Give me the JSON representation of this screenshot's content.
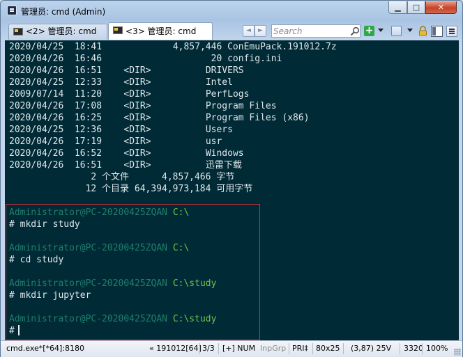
{
  "window": {
    "title": "管理员: cmd (Admin)",
    "controls": {
      "minimize": "▁",
      "maximize": "□",
      "close": "✕"
    }
  },
  "tabs": [
    {
      "label": "<2> 管理员: cmd",
      "active": false
    },
    {
      "label": "<3> 管理员: cmd",
      "active": true
    }
  ],
  "toolbar": {
    "search_placeholder": "Search",
    "nav_left": "◄",
    "nav_right": "►",
    "plus": "+"
  },
  "console": {
    "listing": [
      {
        "date": "2020/04/25",
        "time": "18:41",
        "type": "",
        "size": "4,857,446",
        "name": "ConEmuPack.191012.7z"
      },
      {
        "date": "2020/04/26",
        "time": "16:46",
        "type": "",
        "size": "20",
        "name": "config.ini"
      },
      {
        "date": "2020/04/26",
        "time": "16:51",
        "type": "<DIR>",
        "size": "",
        "name": "DRIVERS"
      },
      {
        "date": "2020/04/25",
        "time": "12:33",
        "type": "<DIR>",
        "size": "",
        "name": "Intel"
      },
      {
        "date": "2009/07/14",
        "time": "11:20",
        "type": "<DIR>",
        "size": "",
        "name": "PerfLogs"
      },
      {
        "date": "2020/04/26",
        "time": "17:08",
        "type": "<DIR>",
        "size": "",
        "name": "Program Files"
      },
      {
        "date": "2020/04/26",
        "time": "16:25",
        "type": "<DIR>",
        "size": "",
        "name": "Program Files (x86)"
      },
      {
        "date": "2020/04/25",
        "time": "12:36",
        "type": "<DIR>",
        "size": "",
        "name": "Users"
      },
      {
        "date": "2020/04/26",
        "time": "17:19",
        "type": "<DIR>",
        "size": "",
        "name": "usr"
      },
      {
        "date": "2020/04/26",
        "time": "16:52",
        "type": "<DIR>",
        "size": "",
        "name": "Windows"
      },
      {
        "date": "2020/04/26",
        "time": "16:51",
        "type": "<DIR>",
        "size": "",
        "name": "迅雷下载"
      }
    ],
    "summary": [
      "               2 个文件      4,857,466 字节",
      "              12 个目录 64,394,973,184 可用字节"
    ],
    "sessions": [
      {
        "user": "Administrator@PC-20200425ZQAN",
        "path": "C:\\",
        "command": "# mkdir study"
      },
      {
        "user": "Administrator@PC-20200425ZQAN",
        "path": "C:\\",
        "command": "# cd study"
      },
      {
        "user": "Administrator@PC-20200425ZQAN",
        "path": "C:\\study",
        "command": "# mkdir jupyter"
      },
      {
        "user": "Administrator@PC-20200425ZQAN",
        "path": "C:\\study",
        "command": "#"
      }
    ]
  },
  "status": {
    "process": "cmd.exe*[*64]:8180",
    "version": "« 191012[64]",
    "tab_index": "3/3",
    "keys": "[+] NUM",
    "inpgrp": "InpGrp",
    "pri": "PRI‡",
    "size": "80x25",
    "cursor": "(3,87) 25V",
    "pid": "3320",
    "zoom": "100%"
  },
  "colors": {
    "console_bg": "#002a36",
    "console_fg": "#dfe8ea",
    "prompt_user": "#1f7f6c",
    "prompt_path": "#6fc54b",
    "selection_border": "#d0323c"
  }
}
